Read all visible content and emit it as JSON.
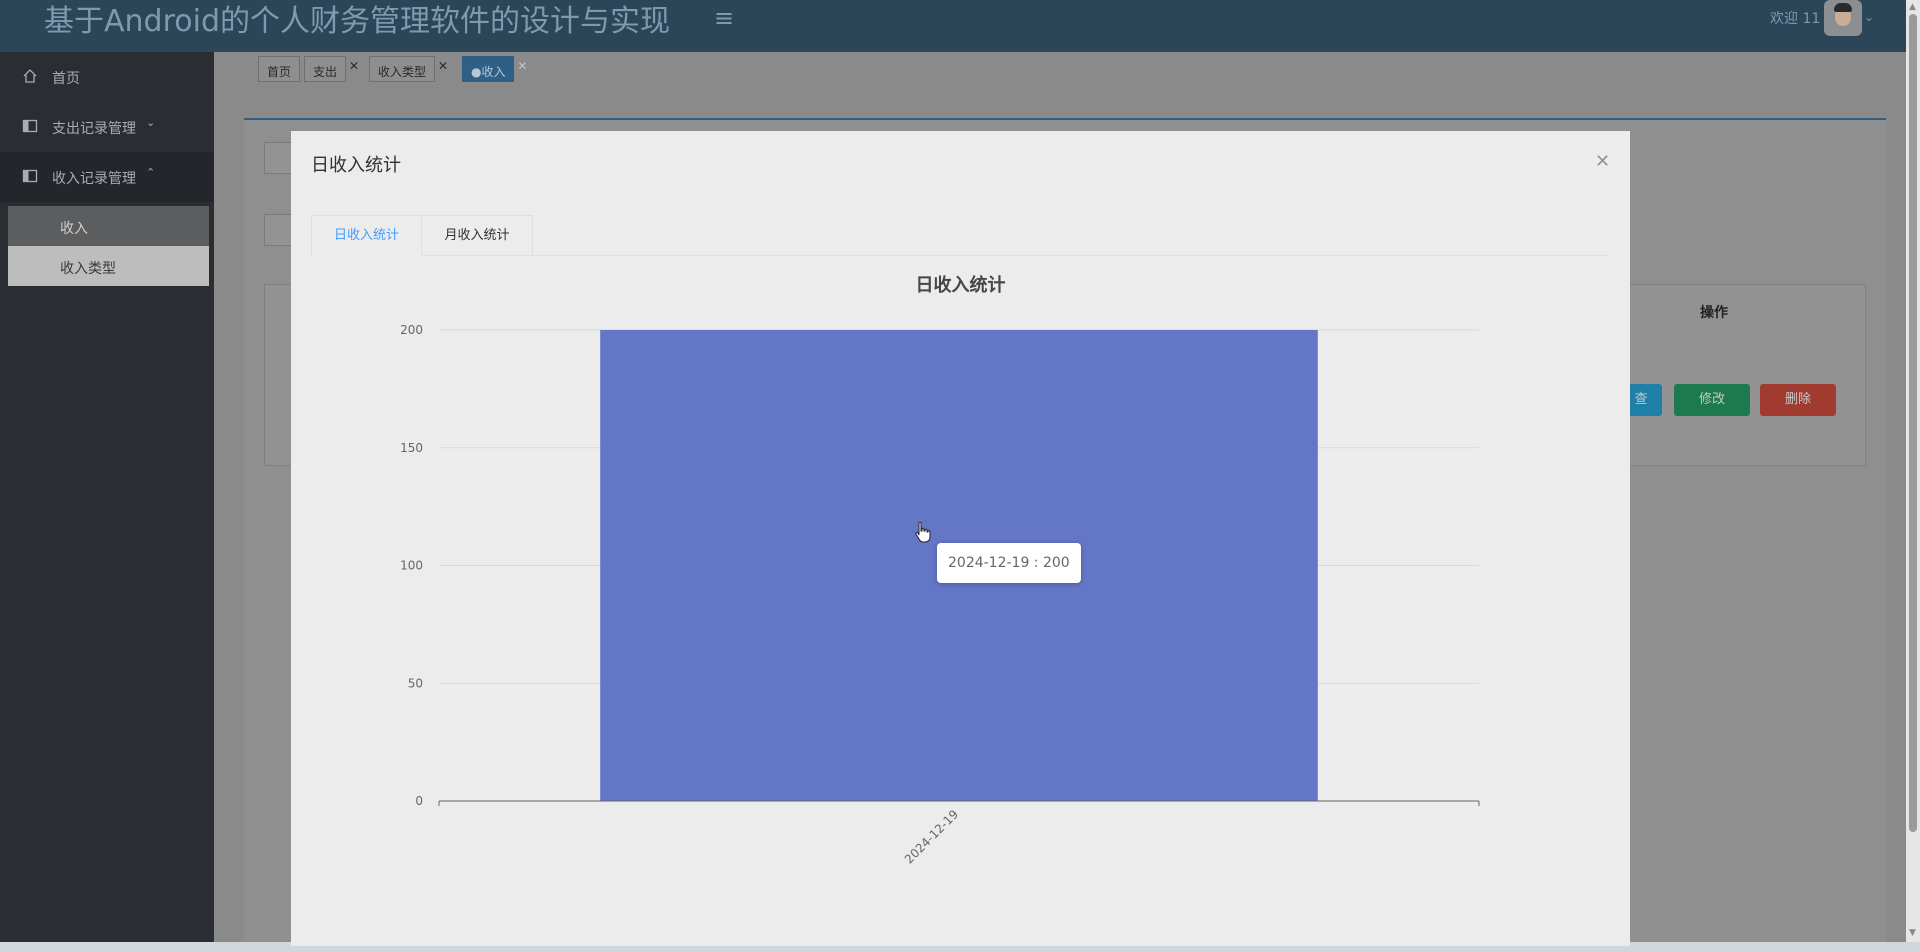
{
  "header": {
    "title": "基于Android的个人财务管理软件的设计与实现",
    "menu_icon": "hamburger-icon",
    "welcome": "欢迎 11"
  },
  "sidebar": {
    "items": [
      {
        "label": "首页",
        "icon": "home-icon"
      },
      {
        "label": "支出记录管理",
        "icon": "panel-icon"
      },
      {
        "label": "收入记录管理",
        "icon": "panel-icon"
      }
    ],
    "subitems": [
      {
        "label": "收入"
      },
      {
        "label": "收入类型"
      }
    ]
  },
  "page_tabs": [
    {
      "label": "首页"
    },
    {
      "label": "支出"
    },
    {
      "label": "收入类型"
    },
    {
      "label": "●收入"
    }
  ],
  "background": {
    "table_header_action": "操作",
    "actions": [
      "查",
      "修改",
      "删除"
    ]
  },
  "modal": {
    "title": "日收入统计",
    "tabs": [
      {
        "label": "日收入统计"
      },
      {
        "label": "月收入统计"
      }
    ],
    "tooltip": "2024-12-19 : 200"
  },
  "chart_data": {
    "type": "bar",
    "title": "日收入统计",
    "categories": [
      "2024-12-19"
    ],
    "values": [
      200
    ],
    "ylim": [
      0,
      200
    ],
    "yticks": [
      0,
      50,
      100,
      150,
      200
    ],
    "grid": true,
    "bar_color": "#6477c7"
  },
  "colors": {
    "header_bg": "#2b4559",
    "sidebar_bg": "#2a2d31",
    "accent": "#409eff",
    "edit_button": "#1d7a4f",
    "delete_button": "#a23b2f"
  }
}
